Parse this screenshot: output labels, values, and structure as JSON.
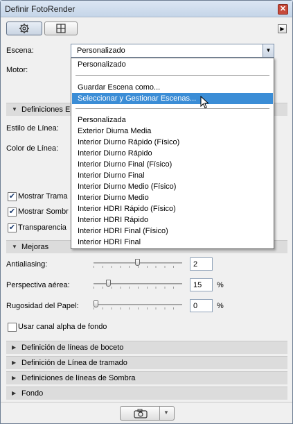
{
  "window": {
    "title": "Definir FotoRender"
  },
  "icons": {
    "settings": "gear-icon",
    "grid": "grid-icon",
    "expand": "triangle-right-icon",
    "camera": "camera-icon"
  },
  "labels": {
    "escena": "Escena:",
    "motor": "Motor:",
    "estilo_linea": "Estilo de Línea:",
    "color_linea": "Color de Línea:"
  },
  "escena_select": {
    "value": "Personalizado"
  },
  "sections": {
    "definiciones_e": "Definiciones E",
    "mejoras": "Mejoras",
    "boceto": "Definición de líneas de boceto",
    "tramado": "Definición de Línea de tramado",
    "sombra": "Definiciones de líneas de Sombra",
    "fondo": "Fondo"
  },
  "checkboxes": {
    "mostrar_trama": {
      "label": "Mostrar Trama",
      "checked": true
    },
    "mostrar_sombra": {
      "label": "Mostrar Sombr",
      "checked": true
    },
    "transparencia": {
      "label": "Transparencia",
      "checked": true
    },
    "alpha": {
      "label": "Usar canal alpha de fondo",
      "checked": false
    }
  },
  "mejoras": {
    "antialiasing": {
      "label": "Antialiasing:",
      "value": "2",
      "unit": "",
      "level": 0.5
    },
    "perspectiva": {
      "label": "Perspectiva aérea:",
      "value": "15",
      "unit": "%",
      "level": 0.15
    },
    "rugosidad": {
      "label": "Rugosidad del Papel:",
      "value": "0",
      "unit": "%",
      "level": 0.0
    }
  },
  "dropdown": {
    "top": [
      "Personalizado"
    ],
    "actions": [
      "Guardar Escena como...",
      "Seleccionar y Gestionar Escenas..."
    ],
    "highlighted": "Seleccionar y Gestionar Escenas...",
    "scenes": [
      "Personalizada",
      "Exterior Diurna Media",
      "Interior Diurno Rápido (Físico)",
      "Interior Diurno Rápido",
      "Interior Diurno Final (Físico)",
      "Interior Diurno Final",
      "Interior Diurno Medio (Físico)",
      "Interior Diurno Medio",
      "Interior HDRI Rápido (Físico)",
      "Interior HDRI Rápido",
      "Interior HDRI Final (Físico)",
      "Interior HDRI Final"
    ]
  },
  "colors": {
    "highlight": "#3b8dd6",
    "section_bg": "#dcdcdc"
  }
}
